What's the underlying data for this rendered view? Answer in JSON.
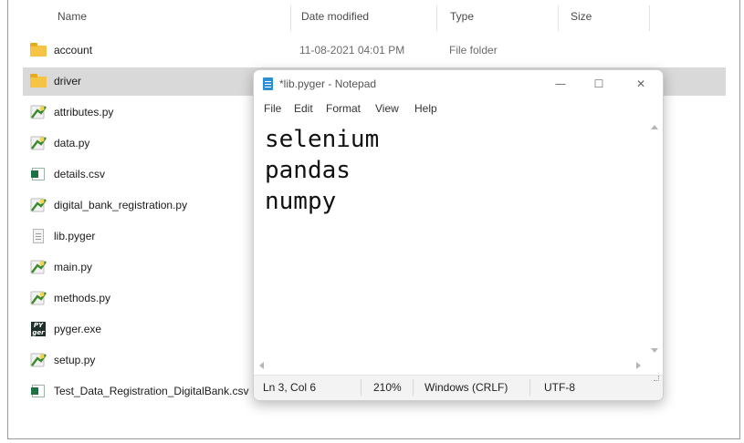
{
  "explorer": {
    "columns": {
      "name": "Name",
      "date_modified": "Date modified",
      "type": "Type",
      "size": "Size"
    },
    "rows": [
      {
        "name": "account",
        "date": "11-08-2021 04:01 PM",
        "type": "File folder",
        "icon": "folder-icon",
        "selected": false
      },
      {
        "name": "driver",
        "date": "",
        "type": "",
        "icon": "folder-icon",
        "selected": true
      },
      {
        "name": "attributes.py",
        "icon": "python-file-icon"
      },
      {
        "name": "data.py",
        "icon": "python-file-icon"
      },
      {
        "name": "details.csv",
        "icon": "csv-file-icon"
      },
      {
        "name": "digital_bank_registration.py",
        "icon": "python-file-icon"
      },
      {
        "name": "lib.pyger",
        "icon": "text-file-icon"
      },
      {
        "name": "main.py",
        "icon": "python-file-icon"
      },
      {
        "name": "methods.py",
        "icon": "python-file-icon"
      },
      {
        "name": "pyger.exe",
        "icon": "pyger-exe-icon"
      },
      {
        "name": "setup.py",
        "icon": "python-file-icon"
      },
      {
        "name": "Test_Data_Registration_DigitalBank.csv",
        "icon": "csv-file-icon"
      }
    ]
  },
  "notepad": {
    "title": "*lib.pyger - Notepad",
    "window_buttons": {
      "minimize": "—",
      "maximize": "☐",
      "close": "✕"
    },
    "menu": [
      "File",
      "Edit",
      "Format",
      "View",
      "Help"
    ],
    "lines": [
      "selenium",
      "pandas",
      "numpy"
    ],
    "status": {
      "position": "Ln 3, Col 6",
      "zoom": "210%",
      "line_endings": "Windows (CRLF)",
      "encoding": "UTF-8"
    }
  },
  "colors": {
    "selection": "#d9d9d9",
    "folder": "#f6c445",
    "python_green": "#3c8a2e",
    "python_yellow": "#f1d54a",
    "csv_green": "#1e7145"
  }
}
